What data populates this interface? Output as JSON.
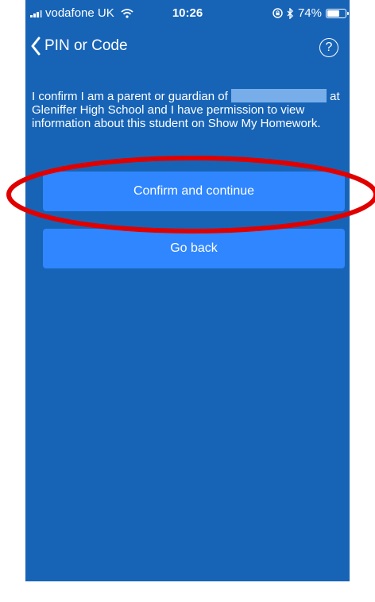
{
  "status_bar": {
    "carrier": "vodafone UK",
    "time": "10:26",
    "battery_percent_label": "74%",
    "battery_level": 0.74
  },
  "nav": {
    "back_label": "PIN or Code",
    "help_symbol": "?"
  },
  "message": {
    "line_start": "I confirm I am a parent or guardian of",
    "line_rest": "at Gleniffer High School and I have permission to view information about this student on Show My Homework."
  },
  "buttons": {
    "confirm_label": "Confirm and continue",
    "goback_label": "Go back"
  },
  "colors": {
    "background": "#1764b7",
    "button": "#2f86ff",
    "annotation": "#e00000",
    "redaction": "#77aee9"
  },
  "icons": [
    "signal-icon",
    "wifi-icon",
    "lock-rotation-icon",
    "bluetooth-icon",
    "battery-icon",
    "back-chevron-icon",
    "help-icon"
  ]
}
